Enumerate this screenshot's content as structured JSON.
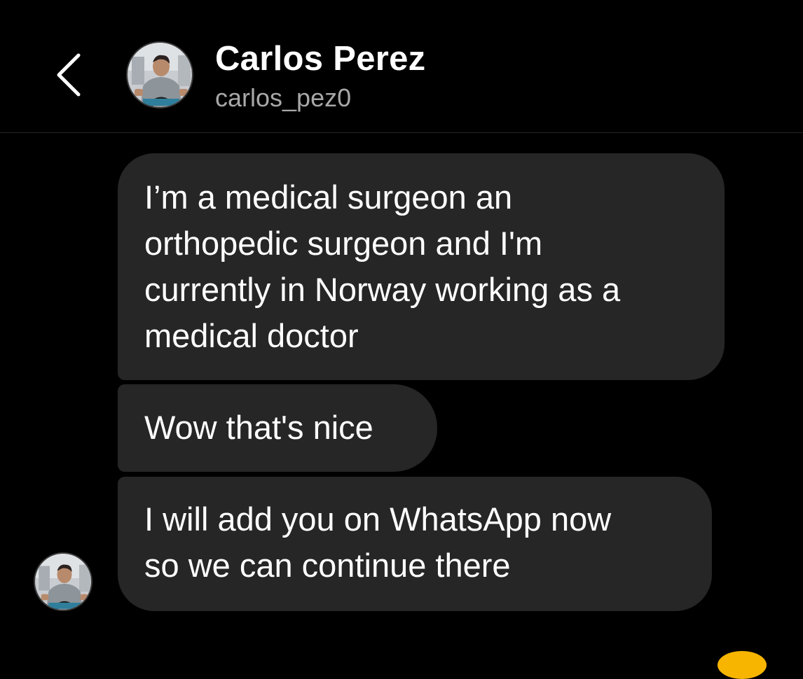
{
  "header": {
    "name": "Carlos Perez",
    "username": "carlos_pez0",
    "back_icon": "chevron-left-icon"
  },
  "messages": [
    {
      "text": "I’m a medical surgeon an\northopedic surgeon and I'm\ncurrently in Norway working as a\nmedical doctor"
    },
    {
      "text": "Wow that's nice"
    },
    {
      "text": "I will add you on WhatsApp now\nso we can continue there"
    }
  ],
  "colors": {
    "background": "#000000",
    "bubble": "#262626",
    "text": "#ffffff",
    "secondary_text": "#a8a8a8",
    "accent": "#f7b500"
  }
}
